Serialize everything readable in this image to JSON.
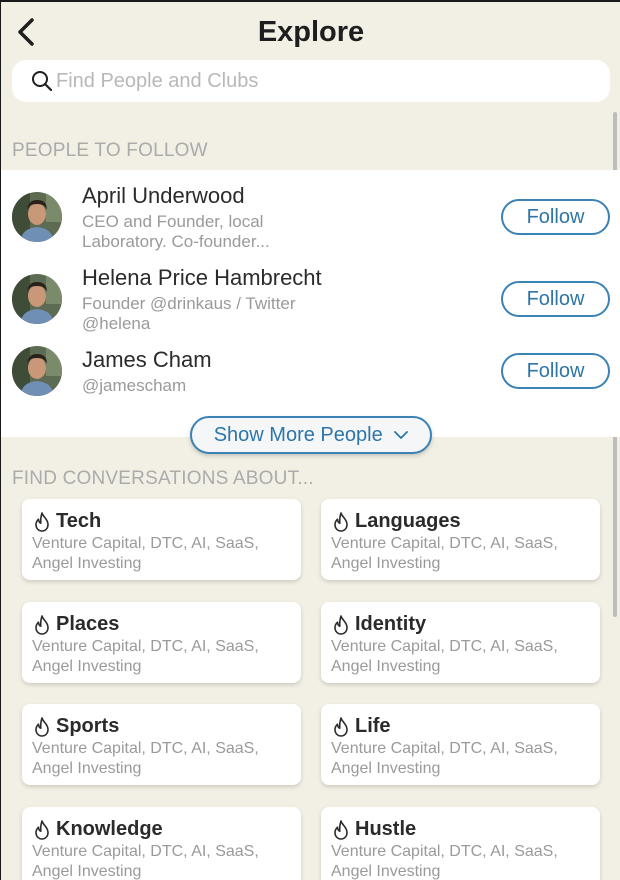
{
  "header": {
    "title": "Explore",
    "back_icon": "chevron-left-icon"
  },
  "search": {
    "placeholder": "Find People and Clubs",
    "value": ""
  },
  "people_section": {
    "title": "PEOPLE TO FOLLOW"
  },
  "people": [
    {
      "name": "April Underwood",
      "bio": "CEO and Founder, local Laboratory. Co-founder...",
      "follow_label": "Follow"
    },
    {
      "name": "Helena Price Hambrecht",
      "bio": "Founder @drinkaus / Twitter @helena",
      "follow_label": "Follow"
    },
    {
      "name": "James Cham",
      "bio": "@jamescham",
      "follow_label": "Follow"
    }
  ],
  "show_more": {
    "label": "Show More People"
  },
  "conversations_section": {
    "title": "FIND CONVERSATIONS ABOUT..."
  },
  "topics": [
    {
      "title": "Tech",
      "desc": "Venture Capital, DTC, AI, SaaS, Angel Investing",
      "icon": "flame-icon"
    },
    {
      "title": "Languages",
      "desc": "Venture Capital, DTC, AI, SaaS, Angel Investing",
      "icon": "flame-icon"
    },
    {
      "title": "Places",
      "desc": "Venture Capital, DTC, AI, SaaS, Angel Investing",
      "icon": "flame-icon"
    },
    {
      "title": "Identity",
      "desc": "Venture Capital, DTC, AI, SaaS, Angel Investing",
      "icon": "flame-icon"
    },
    {
      "title": "Sports",
      "desc": "Venture Capital, DTC, AI, SaaS, Angel Investing",
      "icon": "flame-icon"
    },
    {
      "title": "Life",
      "desc": "Venture Capital, DTC, AI, SaaS, Angel Investing",
      "icon": "flame-icon"
    },
    {
      "title": "Knowledge",
      "desc": "Venture Capital, DTC, AI, SaaS, Angel Investing",
      "icon": "flame-icon"
    },
    {
      "title": "Hustle",
      "desc": "Venture Capital, DTC, AI, SaaS, Angel Investing",
      "icon": "flame-icon"
    }
  ],
  "colors": {
    "background": "#f2efe4",
    "accent": "#2e75a8",
    "muted_text": "#9a9a9a",
    "section_title": "#ababab"
  }
}
